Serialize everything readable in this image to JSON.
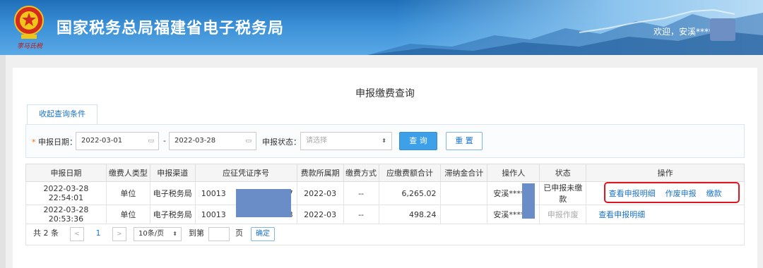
{
  "header": {
    "site_title": "国家税务总局福建省电子税务局",
    "signature": "李马氏税",
    "welcome": "欢迎，安溪****"
  },
  "main": {
    "title": "申报缴费查询",
    "tab_label": "收起查询条件"
  },
  "filter": {
    "date_label": "申报日期：",
    "required_mark": "*",
    "date_from": "2022-03-01",
    "date_sep": "-",
    "date_to": "2022-03-28",
    "status_label": "申报状态：",
    "status_placeholder": "请选择",
    "query_button": "查 询",
    "reset_button": "重 置"
  },
  "table": {
    "columns": [
      "申报日期",
      "缴费人类型",
      "申报渠道",
      "应征凭证序号",
      "费款所属期",
      "缴费方式",
      "应缴费额合计",
      "滞纳金合计",
      "操作人",
      "状态",
      "操作"
    ],
    "rows": [
      {
        "date": "2022-03-28 22:54:01",
        "payer_type": "单位",
        "channel": "电子税务局",
        "voucher_prefix": "10013",
        "voucher_suffix": "7",
        "period": "2022-03",
        "pay_method": "--",
        "amount": "6,265.02",
        "late_fee": "",
        "operator": "安溪****",
        "status": "已申报未缴款",
        "actions": [
          "查看申报明细",
          "作废申报",
          "缴款"
        ]
      },
      {
        "date": "2022-03-28 20:53:36",
        "payer_type": "单位",
        "channel": "电子税务局",
        "voucher_prefix": "10013",
        "voucher_suffix": "3",
        "period": "2022-03",
        "pay_method": "--",
        "amount": "498.24",
        "late_fee": "",
        "operator": "安溪****",
        "status": "申报作废",
        "actions": [
          "查看申报明细"
        ]
      }
    ]
  },
  "pager": {
    "total_prefix": "共",
    "total_count": "2",
    "total_suffix": "条",
    "prev": "<",
    "current_page": "1",
    "next": ">",
    "page_size": "10条/页",
    "goto_label": "到第",
    "page_unit": "页",
    "confirm": "确定"
  },
  "colors": {
    "link": "#1a73c8",
    "primary": "#3da0e8",
    "highlight": "#e0141e"
  }
}
